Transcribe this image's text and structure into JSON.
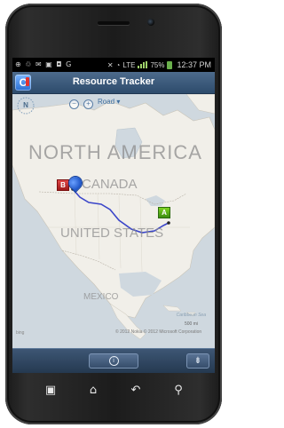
{
  "status_bar": {
    "left_icons": [
      "usb-icon",
      "recycle-icon",
      "chat-icon",
      "image-icon",
      "sim-icon",
      "g-icon"
    ],
    "left_glyphs": "⊕ ♲ ✉ ▣ ◘ G",
    "network": "LTE",
    "battery_percent": "75%",
    "time": "12:37 PM"
  },
  "app": {
    "title": "Resource Tracker",
    "logo_letter": "C"
  },
  "map": {
    "compass_label": "N",
    "zoom_in": "+",
    "zoom_out": "−",
    "mode": "Road ▾",
    "labels": {
      "continent": "NORTH AMERICA",
      "canada": "CANADA",
      "usa": "UNITED STATES",
      "mexico": "MEXICO",
      "sea": "Caribbean Sea"
    },
    "scale": "500 mi",
    "copyright": "© 2012 Nokia   © 2012 Microsoft Corporation",
    "brand": "bing",
    "markers": {
      "a": "A",
      "b": "B"
    },
    "route_color": "#3b46c9"
  },
  "bottom_bar": {
    "center_icon": "info-icon",
    "center_glyph": "i",
    "right_icon": "settings-sliders-icon",
    "right_glyph": "⇟"
  },
  "hardware_keys": {
    "menu": "▣",
    "home": "⌂",
    "back": "↶",
    "search": "⚲"
  }
}
